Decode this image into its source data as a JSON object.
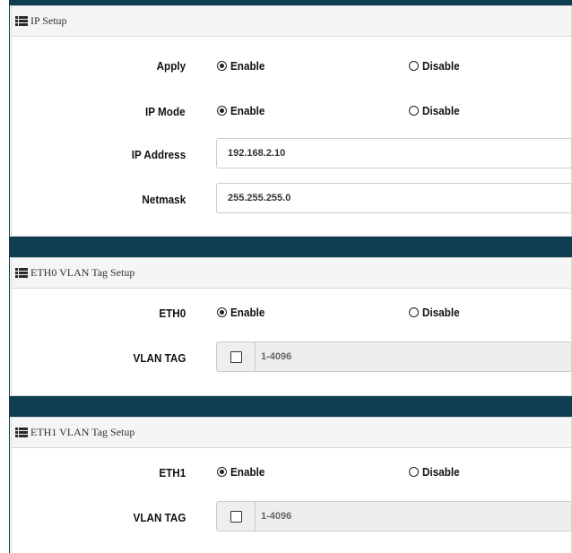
{
  "ip_setup": {
    "title": "IP Setup",
    "apply": {
      "label": "Apply",
      "enable_label": "Enable",
      "disable_label": "Disable",
      "selected": "Enable"
    },
    "ip_mode": {
      "label": "IP Mode",
      "enable_label": "Enable",
      "disable_label": "Disable",
      "selected": "Enable"
    },
    "ip_address": {
      "label": "IP Address",
      "value": "192.168.2.10"
    },
    "netmask": {
      "label": "Netmask",
      "value": "255.255.255.0"
    }
  },
  "eth0_vlan": {
    "title": "ETH0 VLAN Tag Setup",
    "eth": {
      "label": "ETH0",
      "enable_label": "Enable",
      "disable_label": "Disable",
      "selected": "Enable"
    },
    "vlan_tag": {
      "label": "VLAN TAG",
      "checked": false,
      "placeholder": "1-4096"
    }
  },
  "eth1_vlan": {
    "title": "ETH1 VLAN Tag Setup",
    "eth": {
      "label": "ETH1",
      "enable_label": "Enable",
      "disable_label": "Disable",
      "selected": "Enable"
    },
    "vlan_tag": {
      "label": "VLAN TAG",
      "checked": false,
      "placeholder": "1-4096"
    }
  },
  "colors": {
    "band": "#0d3d4f",
    "header_bg": "#f5f5f5",
    "border": "#d9d9d9",
    "disabled_input_bg": "#eeeeee"
  },
  "icons": {
    "section_header": "list-icon"
  }
}
